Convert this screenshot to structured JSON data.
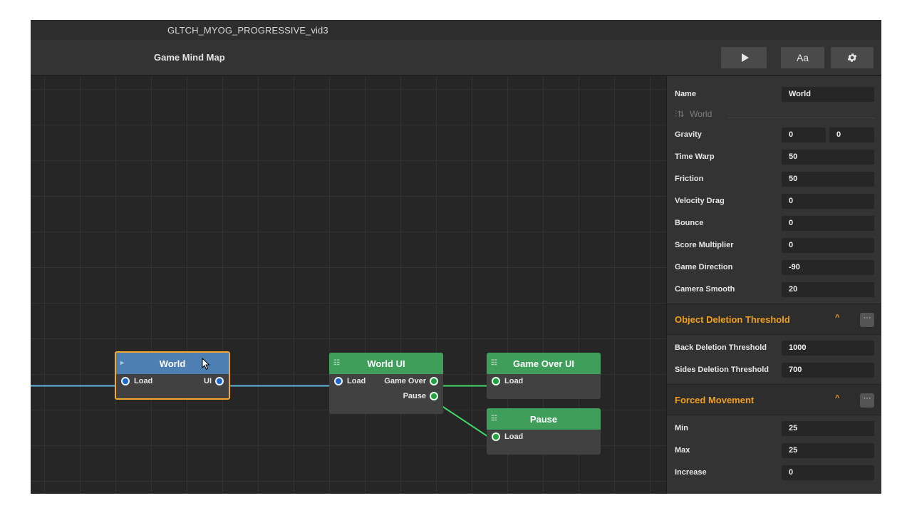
{
  "window": {
    "title": "GLTCH_MYOG_PROGRESSIVE_vid3"
  },
  "toolbar": {
    "map_title": "Game Mind Map",
    "play_icon": "play-icon",
    "font_label": "Aa",
    "settings_icon": "gear-icon"
  },
  "nodes": {
    "world": {
      "title": "World",
      "input": "Load",
      "output": "UI",
      "icon": "entry-arrow-icon"
    },
    "world_ui": {
      "title": "World UI",
      "input": "Load",
      "outputs": [
        "Game Over",
        "Pause"
      ],
      "icon": "list-icon"
    },
    "game_over_ui": {
      "title": "Game Over UI",
      "input": "Load",
      "icon": "list-icon"
    },
    "pause": {
      "title": "Pause",
      "input": "Load",
      "icon": "list-icon"
    }
  },
  "colors": {
    "selected_border": "#f0a830",
    "world_header": "#4d7fb3",
    "ui_header": "#3f9f5a",
    "wire_blue": "#5fb8e0",
    "wire_green": "#44d66a",
    "section_title": "#f0a020"
  },
  "panel": {
    "name_label": "Name",
    "name_value": "World",
    "subtitle": "World",
    "gravity": {
      "label": "Gravity",
      "x": "0",
      "y": "0"
    },
    "properties": [
      {
        "label": "Time Warp",
        "value": "50"
      },
      {
        "label": "Friction",
        "value": "50"
      },
      {
        "label": "Velocity Drag",
        "value": "0"
      },
      {
        "label": "Bounce",
        "value": "0"
      },
      {
        "label": "Score Multiplier",
        "value": "0"
      },
      {
        "label": "Game Direction",
        "value": "-90"
      },
      {
        "label": "Camera Smooth",
        "value": "20"
      }
    ],
    "sections": [
      {
        "title": "Object Deletion Threshold",
        "more": "···",
        "rows": [
          {
            "label": "Back Deletion Threshold",
            "value": "1000"
          },
          {
            "label": "Sides Deletion Threshold",
            "value": "700"
          }
        ]
      },
      {
        "title": "Forced Movement",
        "more": "···",
        "rows": [
          {
            "label": "Min",
            "value": "25"
          },
          {
            "label": "Max",
            "value": "25"
          },
          {
            "label": "Increase",
            "value": "0"
          }
        ]
      }
    ]
  }
}
